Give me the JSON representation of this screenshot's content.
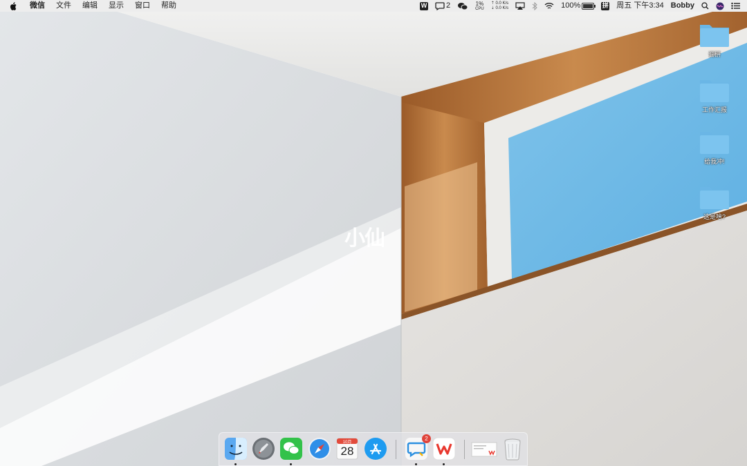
{
  "menubar": {
    "app_name": "微信",
    "menus": [
      "文件",
      "编辑",
      "显示",
      "窗口",
      "帮助"
    ],
    "status": {
      "chat_count": "2",
      "cpu_percent": "1%",
      "cpu_label": "CPU",
      "net_up": "0.0 K/s",
      "net_down": "0.0 K/s",
      "battery": "100%",
      "battery_level": 1.0,
      "input_method": "拼",
      "clock": "周五 下午3:34",
      "user": "Bobby"
    }
  },
  "desktop_icons": [
    {
      "label": "调研",
      "icon": "folder-icon"
    },
    {
      "label": "工作汇报",
      "icon": "folder-icon"
    },
    {
      "label": "给我冲!",
      "icon": "folder-icon"
    },
    {
      "label": "这是啥?",
      "icon": "folder-icon"
    }
  ],
  "watermark": "小仙",
  "dock": {
    "calendar_month": "10月",
    "calendar_day": "28",
    "chat_badge": "2"
  },
  "colors": {
    "folder": "#7cc4ef",
    "folder_tab": "#6ab6e6",
    "accent_badge": "#e0433a"
  }
}
